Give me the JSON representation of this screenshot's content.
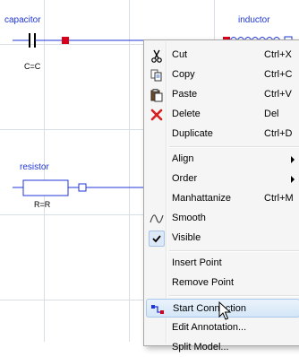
{
  "diagram": {
    "capacitor": {
      "name": "capacitor",
      "param": "C=C"
    },
    "inductor": {
      "name": "inductor"
    },
    "resistor": {
      "name": "resistor",
      "param": "R=R"
    },
    "colors": {
      "wire": "#1f36d8",
      "port_filled": "#d8001a",
      "name_text": "#1f36d8"
    }
  },
  "menu": {
    "items": [
      {
        "id": "cut",
        "label": "Cut",
        "shortcut": "Ctrl+X",
        "icon": "scissors-icon"
      },
      {
        "id": "copy",
        "label": "Copy",
        "shortcut": "Ctrl+C",
        "icon": "copy-icon"
      },
      {
        "id": "paste",
        "label": "Paste",
        "shortcut": "Ctrl+V",
        "icon": "paste-icon"
      },
      {
        "id": "delete",
        "label": "Delete",
        "shortcut": "Del",
        "icon": "delete-x-icon"
      },
      {
        "id": "duplicate",
        "label": "Duplicate",
        "shortcut": "Ctrl+D"
      },
      {
        "id": "align",
        "label": "Align",
        "submenu": true
      },
      {
        "id": "order",
        "label": "Order",
        "submenu": true
      },
      {
        "id": "manhattanize",
        "label": "Manhattanize",
        "shortcut": "Ctrl+M"
      },
      {
        "id": "smooth",
        "label": "Smooth",
        "icon": "smooth-curve-icon"
      },
      {
        "id": "visible",
        "label": "Visible",
        "icon": "checkmark-icon",
        "checked": true
      },
      {
        "id": "insert-point",
        "label": "Insert Point"
      },
      {
        "id": "remove-point",
        "label": "Remove Point"
      },
      {
        "id": "start-connection",
        "label": "Start Connection",
        "icon": "connection-icon",
        "highlighted": true
      },
      {
        "id": "edit-annotation",
        "label": "Edit Annotation..."
      },
      {
        "id": "split-model",
        "label": "Split Model..."
      }
    ]
  }
}
